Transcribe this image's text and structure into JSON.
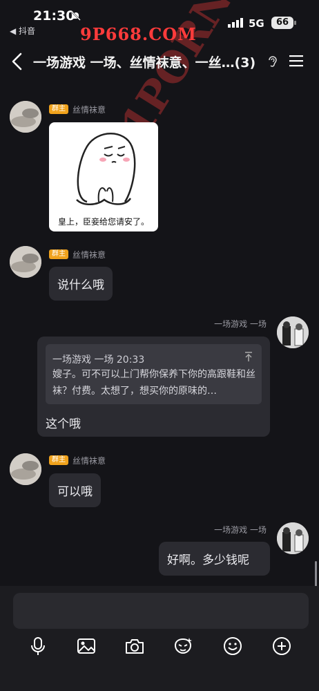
{
  "status_bar": {
    "time": "21:30",
    "back_app_label": "◀ 抖音",
    "network": "5G",
    "battery": "66"
  },
  "watermark_text": "9P668.COM",
  "watermark_diag": "91PORN.COM",
  "header": {
    "title": "一场游戏 一场、丝情袜意、一丝…(3)"
  },
  "messages": [
    {
      "sender": "丝情袜意",
      "badge": "群主",
      "type": "sticker",
      "caption": "皇上，臣妾给您请安了。"
    },
    {
      "sender": "丝情袜意",
      "badge": "群主",
      "type": "text",
      "text": "说什么哦"
    },
    {
      "sender": "一场游戏 一场",
      "type": "text",
      "quote_header": "一场游戏 一场 20:33",
      "quote_text": "嫂子。可不可以上门帮你保养下你的高跟鞋和丝袜？付费。太想了，想买你的原味的…",
      "text": "这个哦"
    },
    {
      "sender": "丝情袜意",
      "badge": "群主",
      "type": "text",
      "text": "可以哦"
    },
    {
      "sender": "一场游戏 一场",
      "type": "text",
      "text": "好啊。多少钱呢"
    }
  ],
  "composer": {
    "input_value": "",
    "tools": [
      "microphone-icon",
      "image-icon",
      "camera-icon",
      "sticker-icon",
      "emoji-icon",
      "plus-icon"
    ]
  }
}
